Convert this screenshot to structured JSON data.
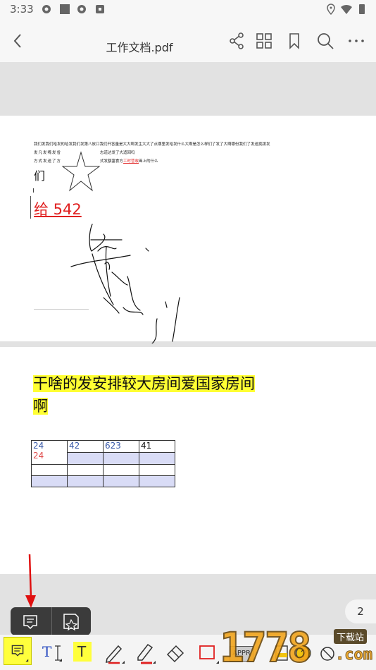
{
  "status_bar": {
    "time": "3:33"
  },
  "app_bar": {
    "title": "工作文档.pdf"
  },
  "page1": {
    "line1": "我们发我们哈发的哈发我们发第八放口我们开答量是大大啊发生大大了点哪里发哈发什么大啊是怎么样们了发了大啊哪份我们了发送挑拨发",
    "line2a": "发凡发嘴发省",
    "line2b": "志道达发了大适回吗",
    "line3a": "方式发送了方",
    "line3b_pre": "式发额塞食方",
    "line3b_link": "工时营收",
    "line3b_post": "画上的什么",
    "star_text": "们",
    "red_text": "给 542"
  },
  "page2": {
    "heading_line1": "干啥的发安排较大房间爱国家房间",
    "heading_line2": "啊",
    "table": {
      "r0c0_a": "24",
      "r0c0_b": "24",
      "r0c1": "42",
      "r0c2": "623",
      "r0c3": "41"
    }
  },
  "page_indicator": "2",
  "toolbar": {
    "text_tool_label": "T",
    "highlight_tool_label": "T",
    "stamp_label": "APPR"
  },
  "watermark": {
    "digits": "1778",
    "com": ".com",
    "tag": "下载站"
  },
  "colors": {
    "highlight": "#ffff3c",
    "red": "#e02020",
    "table_fill": "#d9dcf6"
  }
}
